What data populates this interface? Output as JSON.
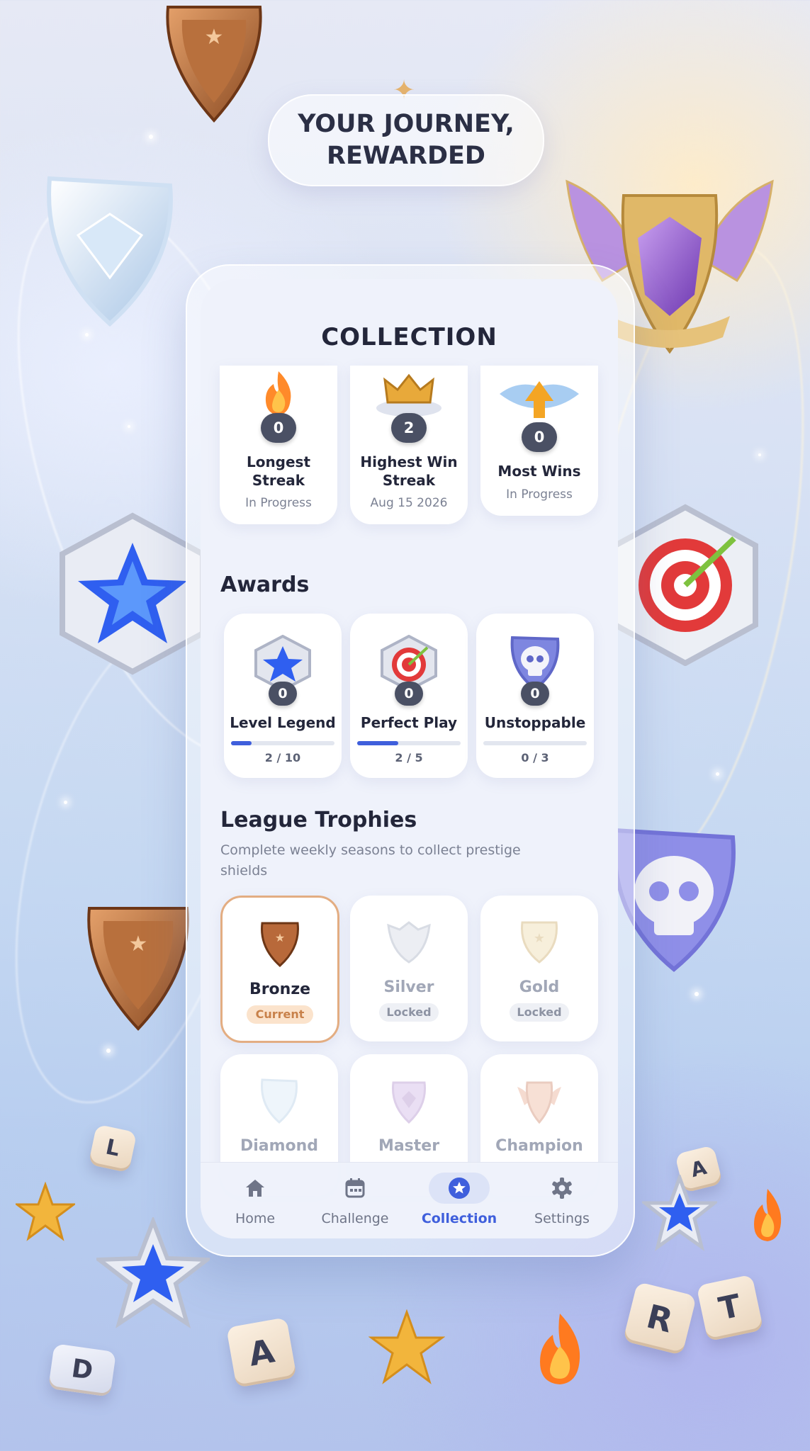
{
  "headline": {
    "line1": "YOUR JOURNEY,",
    "line2": "REWARDED"
  },
  "screen": {
    "title": "COLLECTION"
  },
  "stats": [
    {
      "count": "0",
      "label_line1": "Longest",
      "label_line2": "Streak",
      "sub": "In Progress",
      "icon": "flame-icon"
    },
    {
      "count": "2",
      "label_line1": "Highest Win",
      "label_line2": "Streak",
      "sub": "Aug 15 2026",
      "icon": "crown-icon"
    },
    {
      "count": "0",
      "label_line1": "Most Wins",
      "label_line2": "",
      "sub": "In Progress",
      "icon": "winged-arrow-icon"
    }
  ],
  "awards": {
    "heading": "Awards",
    "items": [
      {
        "count": "0",
        "label": "Level Legend",
        "progress": "2 / 10",
        "fraction": 0.2,
        "icon": "star-badge-icon"
      },
      {
        "count": "0",
        "label": "Perfect Play",
        "progress": "2 / 5",
        "fraction": 0.4,
        "icon": "target-badge-icon"
      },
      {
        "count": "0",
        "label": "Unstoppable",
        "progress": "0 / 3",
        "fraction": 0.0,
        "icon": "skull-badge-icon"
      }
    ]
  },
  "trophies": {
    "heading": "League Trophies",
    "subtitle_line1": "Complete weekly seasons to collect prestige",
    "subtitle_line2": "shields",
    "items": [
      {
        "name": "Bronze",
        "status": "Current"
      },
      {
        "name": "Silver",
        "status": "Locked"
      },
      {
        "name": "Gold",
        "status": "Locked"
      },
      {
        "name": "Diamond",
        "status": ""
      },
      {
        "name": "Master",
        "status": ""
      },
      {
        "name": "Champion",
        "status": ""
      }
    ]
  },
  "nav": [
    {
      "label": "Home",
      "icon": "home-icon"
    },
    {
      "label": "Challenge",
      "icon": "calendar-icon"
    },
    {
      "label": "Collection",
      "icon": "star-circle-icon",
      "active": true
    },
    {
      "label": "Settings",
      "icon": "gear-icon"
    }
  ],
  "tiles": {
    "t1": "L",
    "t2": "A",
    "t3": "D",
    "t4": "A",
    "t5": "R",
    "t6": "T"
  },
  "colors": {
    "accent": "#3f5fdc",
    "bronze": "#c8814a",
    "text": "#23263a",
    "muted": "#7b8193"
  }
}
